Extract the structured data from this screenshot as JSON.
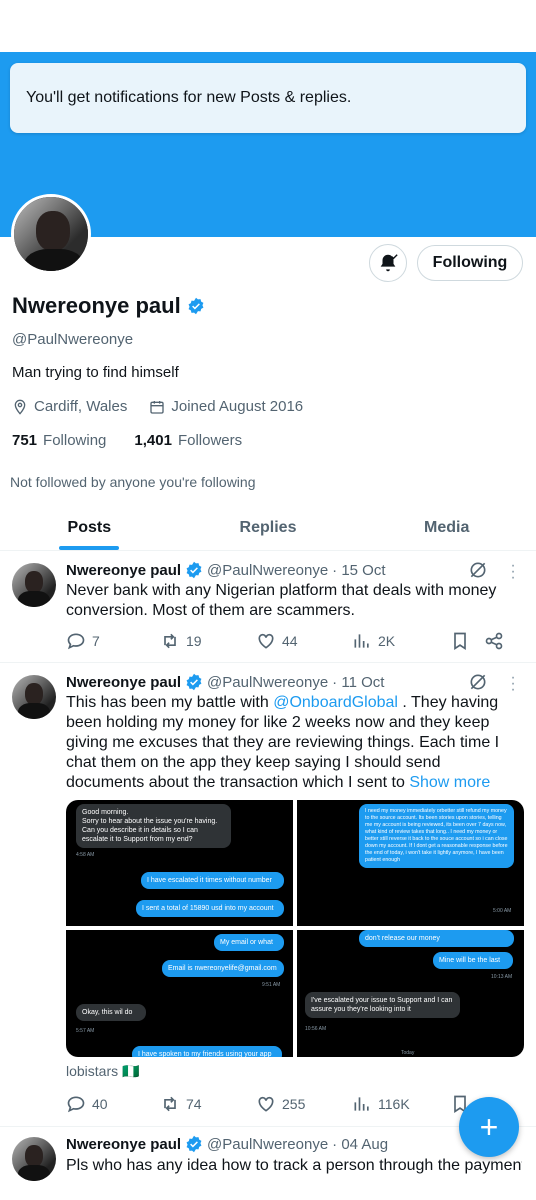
{
  "toast": {
    "text": "You'll get notifications for new Posts & replies."
  },
  "profile": {
    "follow_label": "Following",
    "name": "Nwereonye paul",
    "handle": "@PaulNwereonye",
    "bio": "Man trying to find himself",
    "location": "Cardiff, Wales",
    "joined": "Joined August 2016",
    "following_count": "751",
    "following_label": "Following",
    "followers_count": "1,401",
    "followers_label": "Followers",
    "not_followed": "Not followed by anyone you're following"
  },
  "tabs": [
    {
      "label": "Posts",
      "active": true
    },
    {
      "label": "Replies",
      "active": false
    },
    {
      "label": "Media",
      "active": false
    }
  ],
  "posts": [
    {
      "name": "Nwereonye paul",
      "handle": "@PaulNwereonye",
      "date": "· 15 Oct",
      "text": "Never bank with any Nigerian platform that deals with money conversion. Most of them are scammers.",
      "replies": "7",
      "reposts": "19",
      "likes": "44",
      "views": "2K"
    },
    {
      "name": "Nwereonye paul",
      "handle": "@PaulNwereonye",
      "date": "· 11 Oct",
      "text_before": "This has been my battle with ",
      "mention": "@OnboardGlobal",
      "text_after": " . They having been holding my money for like 2 weeks now and they keep giving me excuses that they are reviewing things. Each time I chat them on the app they keep saying I should send documents about the transaction which I sent to ",
      "show_more": "Show more",
      "source": "lobistars 🇳🇬",
      "replies": "40",
      "reposts": "74",
      "likes": "255",
      "views": "116K",
      "images": {
        "q1": {
          "in1": "Good morning.\nSorry to hear about the issue you're having.\nCan you describe it in details so I can escalate it to Support from my end?",
          "t1": "4:58 AM",
          "out1": "I have escalated it times without number",
          "out2": "I sent a total of 15890 usd into my account"
        },
        "q2": {
          "out1": "I need my money immediately orbetter still refund my money to the source account. Its been stories upon stories, telling me my account is being reviewed, its been over 7 days now, what kind of review takes that long.. I need my money or better still reverse it back to the souce account so i can close down my account. If I dont get a reasonable response before the end of today, i won't take it lightly anymore, I have been patient enough",
          "t1": "5:00 AM"
        },
        "q3": {
          "out1": "My email or what",
          "out2": "Email is nwereonyelife@gmail.com",
          "t1": "9:51 AM",
          "in1": "Okay, this wil do",
          "t2": "5:57 AM",
          "out3": "I have spoken to my friends using your app"
        },
        "q4": {
          "out1": "don't release our money",
          "out2": "Mine will be the last",
          "t1": "10:13 AM",
          "in1": "I've escalated your issue to Support and I can assure you they're looking into it",
          "t2": "10:56 AM",
          "t3": "Today"
        }
      }
    },
    {
      "name": "Nwereonye paul",
      "handle": "@PaulNwereonye",
      "date": "· 04 Aug",
      "text": "Pls who has any idea how to track a person through the payment"
    }
  ],
  "fab": {
    "label": "+"
  },
  "colors": {
    "accent": "#1d9bf0",
    "text": "#0f1419",
    "muted": "#536471"
  }
}
